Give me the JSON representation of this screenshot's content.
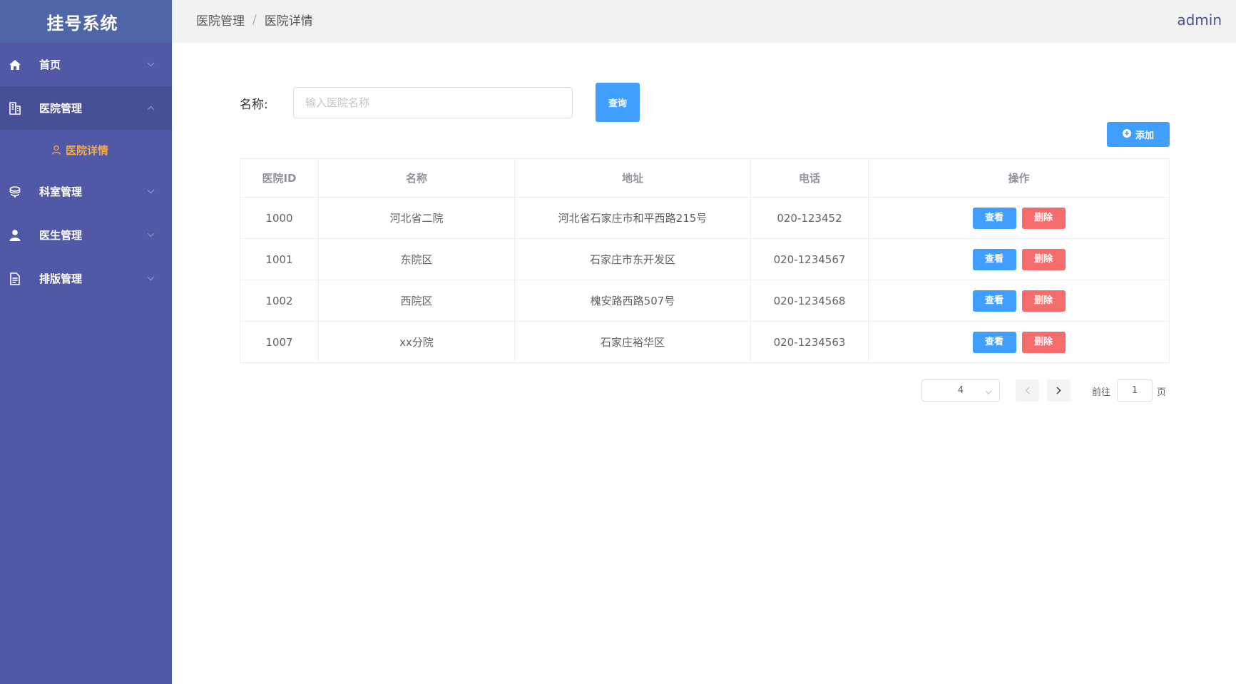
{
  "sidebar": {
    "brand": "挂号系统",
    "items": [
      {
        "label": "首页",
        "icon": "home-icon"
      },
      {
        "label": "医院管理",
        "icon": "building-icon",
        "expanded": true,
        "children": [
          {
            "label": "医院详情",
            "icon": "user-icon",
            "active": true
          }
        ]
      },
      {
        "label": "科室管理",
        "icon": "stethoscope-icon"
      },
      {
        "label": "医生管理",
        "icon": "doctor-icon"
      },
      {
        "label": "排版管理",
        "icon": "document-icon"
      }
    ]
  },
  "header": {
    "breadcrumb": [
      "医院管理",
      "医院详情"
    ],
    "separator": "/",
    "user": "admin"
  },
  "search": {
    "label": "名称:",
    "placeholder": "输入医院名称",
    "value": "",
    "button": "查询"
  },
  "actions": {
    "add": "添加"
  },
  "table": {
    "columns": [
      "医院ID",
      "名称",
      "地址",
      "电话",
      "操作"
    ],
    "rows": [
      {
        "id": "1000",
        "name": "河北省二院",
        "address": "河北省石家庄市和平西路215号",
        "phone": "020-123452",
        "view": "查看",
        "delete": "删除"
      },
      {
        "id": "1001",
        "name": "东院区",
        "address": "石家庄市东开发区",
        "phone": "020-1234567",
        "view": "查看",
        "delete": "删除"
      },
      {
        "id": "1002",
        "name": "西院区",
        "address": "槐安路西路507号",
        "phone": "020-1234568",
        "view": "查看",
        "delete": "删除"
      },
      {
        "id": "1007",
        "name": "xx分院",
        "address": "石家庄裕华区",
        "phone": "020-1234563",
        "view": "查看",
        "delete": "删除"
      }
    ]
  },
  "pagination": {
    "page_size": "4",
    "goto_prefix": "前往",
    "goto_value": "1",
    "goto_suffix": "页"
  },
  "colors": {
    "sidebar": "#5159a7",
    "brand": "#4f66a8",
    "primary": "#409eff",
    "danger": "#f56c6c",
    "active_sub": "#f5a94b"
  }
}
